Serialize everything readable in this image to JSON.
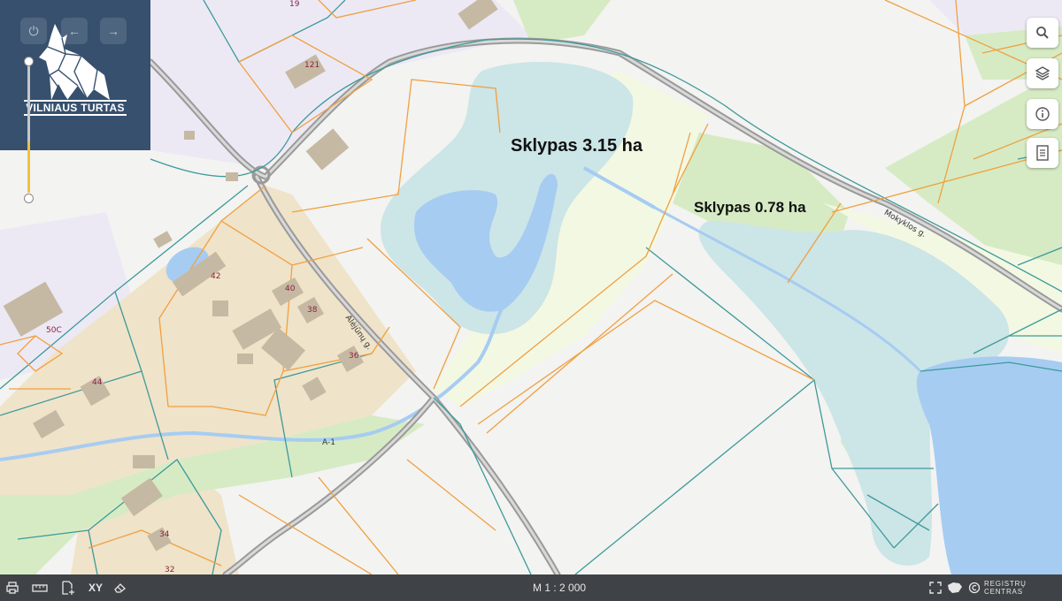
{
  "logo": {
    "brand_text": "VILNIAUS TURTAS",
    "icon": "wolf-logo-icon"
  },
  "nav_controls": [
    {
      "name": "power-icon",
      "glyph": "⏻"
    },
    {
      "name": "arrow-left-icon",
      "glyph": "←"
    },
    {
      "name": "arrow-right-icon",
      "glyph": "→"
    }
  ],
  "map_labels": {
    "parcel_a": "Sklypas 3.15 ha",
    "parcel_b": "Sklypas 0.78 ha"
  },
  "streets": {
    "alleys": "Alėjūnų g.",
    "school": "Mokyklos g.",
    "road": "A-1"
  },
  "house_numbers": [
    "121",
    "42",
    "40",
    "38",
    "36",
    "44",
    "50C",
    "34",
    "32",
    "19"
  ],
  "side_tools": [
    "search-icon",
    "layers-icon",
    "info-icon",
    "document-icon"
  ],
  "bottom_bar": {
    "scale": "M 1 : 2 000",
    "credit": "REGISTRŲ CENTRAS",
    "tools": {
      "ruler": "▭",
      "xy": "XY"
    }
  },
  "colors": {
    "water": "#a6ccf2",
    "wetland": "#cce5e6",
    "grass": "#d6ebc4",
    "residential": "#efe3c9",
    "parcel_orange": "#f0a040",
    "parcel_teal": "#3c9a9a",
    "brand_panel": "#36506e"
  }
}
